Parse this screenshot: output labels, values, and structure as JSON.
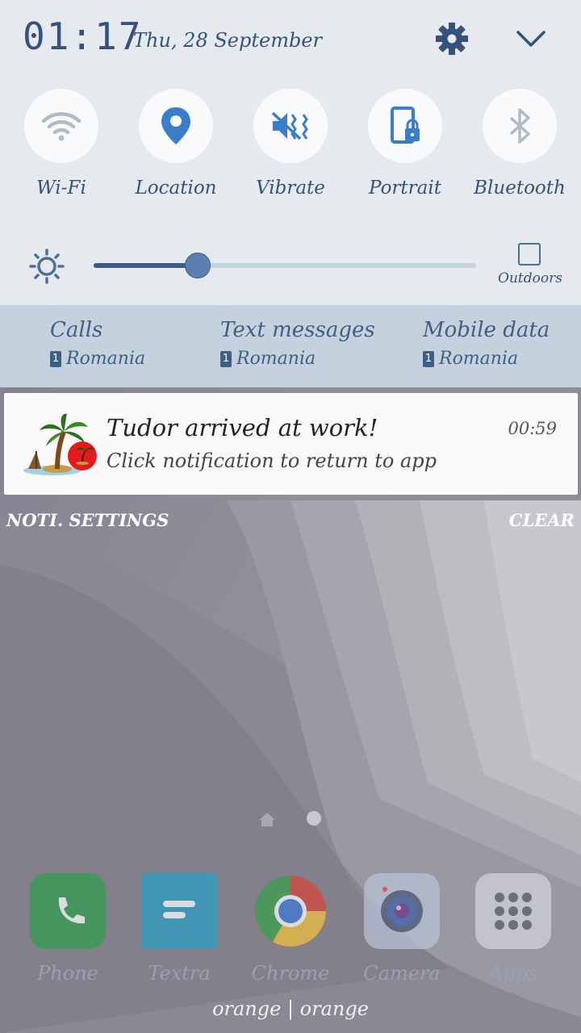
{
  "status": {
    "time": "01:17",
    "date": "Thu, 28 September"
  },
  "quick_settings": [
    {
      "label": "Wi-Fi",
      "icon": "wifi-icon",
      "active": false
    },
    {
      "label": "Location",
      "icon": "location-pin-icon",
      "active": true
    },
    {
      "label": "Vibrate",
      "icon": "vibrate-icon",
      "active": true
    },
    {
      "label": "Portrait",
      "icon": "portrait-lock-icon",
      "active": true
    },
    {
      "label": "Bluetooth",
      "icon": "bluetooth-icon",
      "active": false
    }
  ],
  "brightness": {
    "level": 0.27,
    "outdoors_label": "Outdoors"
  },
  "sim": [
    {
      "title": "Calls",
      "sim_number": "1",
      "carrier": "Romania"
    },
    {
      "title": "Text messages",
      "sim_number": "1",
      "carrier": "Romania"
    },
    {
      "title": "Mobile data",
      "sim_number": "1",
      "carrier": "Romania"
    }
  ],
  "notification": {
    "title": "Tudor arrived at work!",
    "text": "Click notification to return to app",
    "time": "00:59"
  },
  "actions": {
    "settings_label": "NOTI. SETTINGS",
    "clear_label": "CLEAR"
  },
  "dock": [
    {
      "label": "Phone",
      "icon": "phone-icon",
      "color": "#2e9e4f"
    },
    {
      "label": "Textra",
      "icon": "textra-icon",
      "color": "#2a9fc5"
    },
    {
      "label": "Chrome",
      "icon": "chrome-icon",
      "color": "#ffffff"
    },
    {
      "label": "Camera",
      "icon": "camera-icon",
      "color": "#b9c3d6"
    },
    {
      "label": "Apps",
      "icon": "apps-grid-icon",
      "color": "#d4d6dc"
    }
  ],
  "carrier_text": "orange | orange",
  "colors": {
    "accent": "#34527c",
    "active_icon": "#3c7dc7",
    "inactive_icon": "#aebcc8"
  }
}
